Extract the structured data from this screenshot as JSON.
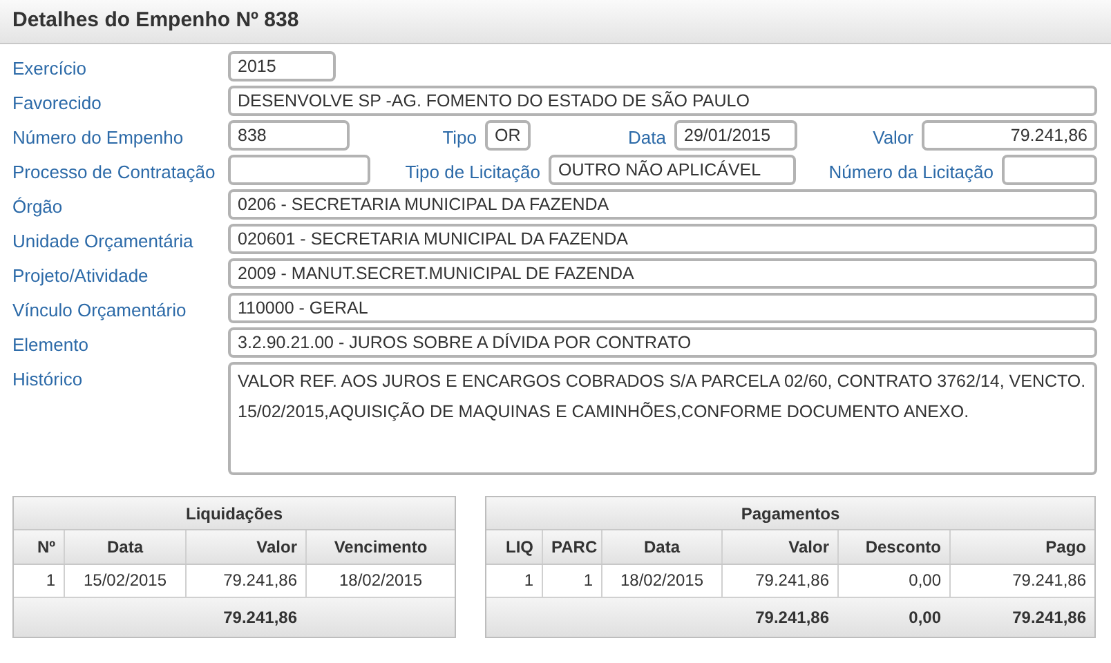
{
  "title": "Detalhes do Empenho Nº 838",
  "rows": [
    {
      "fields": [
        {
          "label": "Exercício",
          "value": "2015"
        }
      ]
    },
    {
      "fields": [
        {
          "label": "Favorecido",
          "value": "DESENVOLVE SP -AG. FOMENTO DO ESTADO DE SÃO PAULO"
        }
      ]
    },
    {
      "fields": [
        {
          "label": "Número do Empenho",
          "value": "838"
        },
        {
          "label": "Tipo",
          "value": "OR"
        },
        {
          "label": "Data",
          "value": "29/01/2015"
        },
        {
          "label": "Valor",
          "value": "79.241,86"
        }
      ]
    },
    {
      "fields": [
        {
          "label": "Processo de Contratação"
        },
        {
          "label": "Tipo de Licitação",
          "value": "OUTRO NÃO APLICÁVEL"
        },
        {
          "label": "Número da Licitação"
        }
      ]
    },
    {
      "fields": [
        {
          "label": "Órgão",
          "value": "0206 - SECRETARIA MUNICIPAL DA FAZENDA"
        }
      ]
    },
    {
      "fields": [
        {
          "label": "Unidade Orçamentária",
          "value": "020601 - SECRETARIA MUNICIPAL DA FAZENDA"
        }
      ]
    },
    {
      "fields": [
        {
          "label": "Projeto/Atividade",
          "value": "2009 - MANUT.SECRET.MUNICIPAL DE FAZENDA"
        }
      ]
    },
    {
      "fields": [
        {
          "label": "Vínculo Orçamentário",
          "value": "110000 - GERAL"
        }
      ]
    },
    {
      "fields": [
        {
          "label": "Elemento",
          "value": "3.2.90.21.00 - JUROS SOBRE A DÍVIDA POR CONTRATO"
        }
      ]
    },
    {
      "fields": [
        {
          "label": "Histórico",
          "value": "VALOR REF. AOS JUROS E ENCARGOS COBRADOS S/A PARCELA 02/60, CONTRATO 3762/14, VENCTO. 15/02/2015,AQUISIÇÃO DE MAQUINAS E CAMINHÕES,CONFORME DOCUMENTO ANEXO."
        }
      ]
    }
  ],
  "tables": [
    {
      "title": "Liquidações",
      "columns": [
        {
          "label": "Nº"
        },
        {
          "label": "Data"
        },
        {
          "label": "Valor",
          "total": "79.241,86"
        },
        {
          "label": "Vencimento"
        }
      ],
      "rows": [
        [
          "1",
          "15/02/2015",
          "79.241,86",
          "18/02/2015"
        ]
      ]
    },
    {
      "title": "Pagamentos",
      "columns": [
        {
          "label": "LIQ"
        },
        {
          "label": "PARC"
        },
        {
          "label": "Data"
        },
        {
          "label": "Valor",
          "total": "79.241,86"
        },
        {
          "label": "Desconto",
          "total": "0,00"
        },
        {
          "label": "Pago",
          "total": "79.241,86"
        }
      ],
      "rows": [
        [
          "1",
          "1",
          "18/02/2015",
          "79.241,86",
          "0,00",
          "79.241,86"
        ]
      ]
    }
  ]
}
